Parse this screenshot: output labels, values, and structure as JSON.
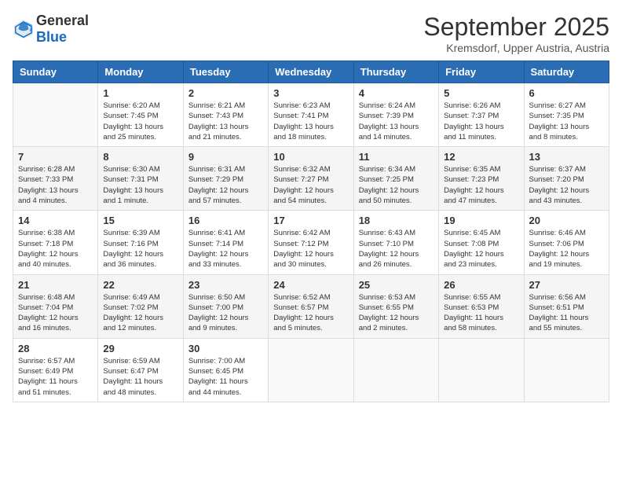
{
  "logo": {
    "general": "General",
    "blue": "Blue"
  },
  "title": "September 2025",
  "location": "Kremsdorf, Upper Austria, Austria",
  "days_of_week": [
    "Sunday",
    "Monday",
    "Tuesday",
    "Wednesday",
    "Thursday",
    "Friday",
    "Saturday"
  ],
  "weeks": [
    [
      {
        "day": "",
        "info": ""
      },
      {
        "day": "1",
        "info": "Sunrise: 6:20 AM\nSunset: 7:45 PM\nDaylight: 13 hours\nand 25 minutes."
      },
      {
        "day": "2",
        "info": "Sunrise: 6:21 AM\nSunset: 7:43 PM\nDaylight: 13 hours\nand 21 minutes."
      },
      {
        "day": "3",
        "info": "Sunrise: 6:23 AM\nSunset: 7:41 PM\nDaylight: 13 hours\nand 18 minutes."
      },
      {
        "day": "4",
        "info": "Sunrise: 6:24 AM\nSunset: 7:39 PM\nDaylight: 13 hours\nand 14 minutes."
      },
      {
        "day": "5",
        "info": "Sunrise: 6:26 AM\nSunset: 7:37 PM\nDaylight: 13 hours\nand 11 minutes."
      },
      {
        "day": "6",
        "info": "Sunrise: 6:27 AM\nSunset: 7:35 PM\nDaylight: 13 hours\nand 8 minutes."
      }
    ],
    [
      {
        "day": "7",
        "info": "Sunrise: 6:28 AM\nSunset: 7:33 PM\nDaylight: 13 hours\nand 4 minutes."
      },
      {
        "day": "8",
        "info": "Sunrise: 6:30 AM\nSunset: 7:31 PM\nDaylight: 13 hours\nand 1 minute."
      },
      {
        "day": "9",
        "info": "Sunrise: 6:31 AM\nSunset: 7:29 PM\nDaylight: 12 hours\nand 57 minutes."
      },
      {
        "day": "10",
        "info": "Sunrise: 6:32 AM\nSunset: 7:27 PM\nDaylight: 12 hours\nand 54 minutes."
      },
      {
        "day": "11",
        "info": "Sunrise: 6:34 AM\nSunset: 7:25 PM\nDaylight: 12 hours\nand 50 minutes."
      },
      {
        "day": "12",
        "info": "Sunrise: 6:35 AM\nSunset: 7:23 PM\nDaylight: 12 hours\nand 47 minutes."
      },
      {
        "day": "13",
        "info": "Sunrise: 6:37 AM\nSunset: 7:20 PM\nDaylight: 12 hours\nand 43 minutes."
      }
    ],
    [
      {
        "day": "14",
        "info": "Sunrise: 6:38 AM\nSunset: 7:18 PM\nDaylight: 12 hours\nand 40 minutes."
      },
      {
        "day": "15",
        "info": "Sunrise: 6:39 AM\nSunset: 7:16 PM\nDaylight: 12 hours\nand 36 minutes."
      },
      {
        "day": "16",
        "info": "Sunrise: 6:41 AM\nSunset: 7:14 PM\nDaylight: 12 hours\nand 33 minutes."
      },
      {
        "day": "17",
        "info": "Sunrise: 6:42 AM\nSunset: 7:12 PM\nDaylight: 12 hours\nand 30 minutes."
      },
      {
        "day": "18",
        "info": "Sunrise: 6:43 AM\nSunset: 7:10 PM\nDaylight: 12 hours\nand 26 minutes."
      },
      {
        "day": "19",
        "info": "Sunrise: 6:45 AM\nSunset: 7:08 PM\nDaylight: 12 hours\nand 23 minutes."
      },
      {
        "day": "20",
        "info": "Sunrise: 6:46 AM\nSunset: 7:06 PM\nDaylight: 12 hours\nand 19 minutes."
      }
    ],
    [
      {
        "day": "21",
        "info": "Sunrise: 6:48 AM\nSunset: 7:04 PM\nDaylight: 12 hours\nand 16 minutes."
      },
      {
        "day": "22",
        "info": "Sunrise: 6:49 AM\nSunset: 7:02 PM\nDaylight: 12 hours\nand 12 minutes."
      },
      {
        "day": "23",
        "info": "Sunrise: 6:50 AM\nSunset: 7:00 PM\nDaylight: 12 hours\nand 9 minutes."
      },
      {
        "day": "24",
        "info": "Sunrise: 6:52 AM\nSunset: 6:57 PM\nDaylight: 12 hours\nand 5 minutes."
      },
      {
        "day": "25",
        "info": "Sunrise: 6:53 AM\nSunset: 6:55 PM\nDaylight: 12 hours\nand 2 minutes."
      },
      {
        "day": "26",
        "info": "Sunrise: 6:55 AM\nSunset: 6:53 PM\nDaylight: 11 hours\nand 58 minutes."
      },
      {
        "day": "27",
        "info": "Sunrise: 6:56 AM\nSunset: 6:51 PM\nDaylight: 11 hours\nand 55 minutes."
      }
    ],
    [
      {
        "day": "28",
        "info": "Sunrise: 6:57 AM\nSunset: 6:49 PM\nDaylight: 11 hours\nand 51 minutes."
      },
      {
        "day": "29",
        "info": "Sunrise: 6:59 AM\nSunset: 6:47 PM\nDaylight: 11 hours\nand 48 minutes."
      },
      {
        "day": "30",
        "info": "Sunrise: 7:00 AM\nSunset: 6:45 PM\nDaylight: 11 hours\nand 44 minutes."
      },
      {
        "day": "",
        "info": ""
      },
      {
        "day": "",
        "info": ""
      },
      {
        "day": "",
        "info": ""
      },
      {
        "day": "",
        "info": ""
      }
    ]
  ]
}
